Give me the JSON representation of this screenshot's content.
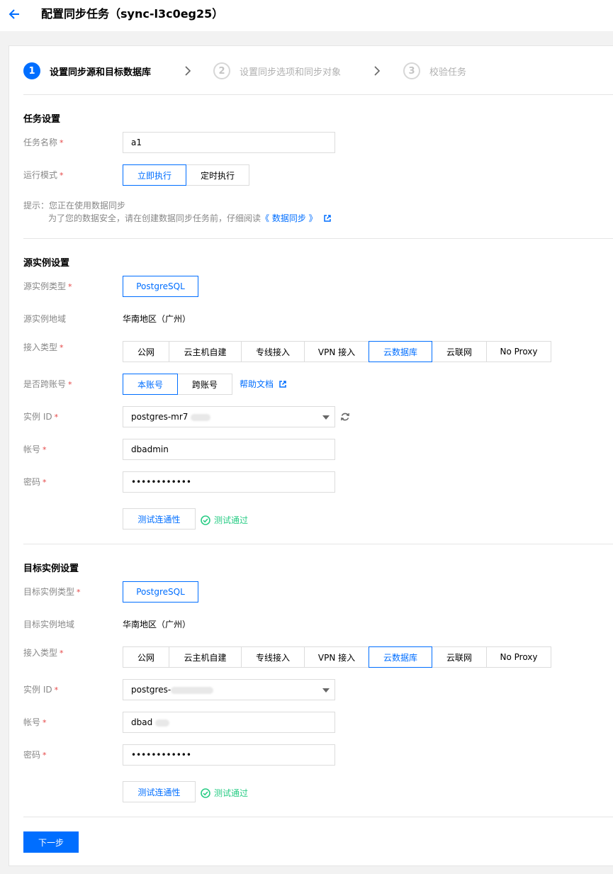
{
  "header": {
    "title": "配置同步任务（sync-l3c0eg25）"
  },
  "steps": [
    {
      "num": "1",
      "label": "设置同步源和目标数据库"
    },
    {
      "num": "2",
      "label": "设置同步选项和同步对象"
    },
    {
      "num": "3",
      "label": "校验任务"
    }
  ],
  "task": {
    "section_title": "任务设置",
    "name_label": "任务名称",
    "name_value": "a1",
    "mode_label": "运行模式",
    "mode_options": [
      "立即执行",
      "定时执行"
    ],
    "hint_line1": "提示：您正在使用数据同步",
    "hint_line2": "为了您的数据安全，请在创建数据同步任务前，仔细阅读",
    "hint_link": "《 数据同步 》"
  },
  "source": {
    "section_title": "源实例设置",
    "type_label": "源实例类型",
    "type_value": "PostgreSQL",
    "region_label": "源实例地域",
    "region_value": "华南地区（广州）",
    "access_label": "接入类型",
    "access_options": [
      "公网",
      "云主机自建",
      "专线接入",
      "VPN 接入",
      "云数据库",
      "云联网",
      "No Proxy"
    ],
    "cross_label": "是否跨账号",
    "cross_options": [
      "本账号",
      "跨账号"
    ],
    "help_link": "帮助文档",
    "instance_label": "实例 ID",
    "instance_value": "postgres-mr7",
    "account_label": "帐号",
    "account_value": "dbadmin",
    "password_label": "密码",
    "password_value": "••••••••••••",
    "test_button": "测试连通性",
    "test_result": "测试通过"
  },
  "target": {
    "section_title": "目标实例设置",
    "type_label": "目标实例类型",
    "type_value": "PostgreSQL",
    "region_label": "目标实例地域",
    "region_value": "华南地区（广州）",
    "access_label": "接入类型",
    "access_options": [
      "公网",
      "云主机自建",
      "专线接入",
      "VPN 接入",
      "云数据库",
      "云联网",
      "No Proxy"
    ],
    "instance_label": "实例 ID",
    "instance_value": "postgres-",
    "account_label": "帐号",
    "account_value": "dbad",
    "password_label": "密码",
    "password_value": "••••••••••••",
    "test_button": "测试连通性",
    "test_result": "测试通过"
  },
  "footer": {
    "next_button": "下一步"
  },
  "colors": {
    "primary": "#006eff",
    "success": "#29cc85",
    "required": "#e54545"
  }
}
